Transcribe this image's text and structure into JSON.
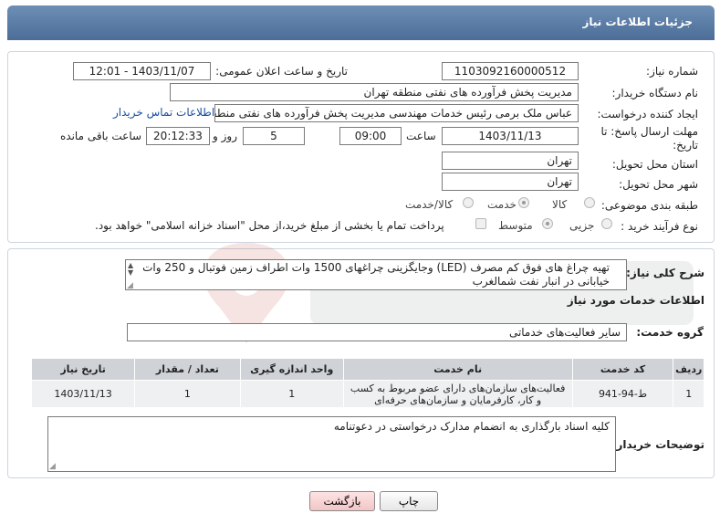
{
  "header": {
    "title": "جزئیات اطلاعات نیاز"
  },
  "form": {
    "need_number": {
      "label": "شماره نیاز:",
      "value": "1103092160000512"
    },
    "announce_datetime": {
      "label": "تاریخ و ساعت اعلان عمومی:",
      "value": "1403/11/07 - 12:01"
    },
    "buyer_org": {
      "label": "نام دستگاه خریدار:",
      "value": "مدیریت پخش فرآورده های نفتی منطقه تهران"
    },
    "requester": {
      "label": "ایجاد کننده درخواست:",
      "value": "عباس ملک برمی رئیس خدمات مهندسی مدیریت پخش فرآورده های نفتی منطقه تهران",
      "contact_link": "اطلاعات تماس خریدار"
    },
    "deadline": {
      "label_line1": "مهلت ارسال پاسخ: تا",
      "label_line2": "تاریخ:",
      "date": "1403/11/13",
      "time_label": "ساعت",
      "time": "09:00",
      "days": "5",
      "days_label": "روز و",
      "remaining": "20:12:33",
      "remaining_label": "ساعت باقی مانده"
    },
    "province": {
      "label": "استان محل تحویل:",
      "value": "تهران"
    },
    "city": {
      "label": "شهر محل تحویل:",
      "value": "تهران"
    },
    "category": {
      "label": "طبقه بندی موضوعی:",
      "options": [
        "کالا",
        "خدمت",
        "کالا/خدمت"
      ],
      "selected": "خدمت"
    },
    "purchase_type": {
      "label": "نوع فرآیند خرید :",
      "options": [
        "جزیی",
        "متوسط"
      ],
      "selected": "متوسط",
      "treasury_note": "پرداخت تمام یا بخشی از مبلغ خرید،از محل \"اسناد خزانه اسلامی\" خواهد بود."
    }
  },
  "summary": {
    "label": "شرح کلی نیاز:",
    "text": "تهیه چراغ های فوق کم مصرف (LED) وجایگزینی چراغهای 1500 وات اطراف زمین فوتبال و 250 وات خیابانی در انبار نفت شمالغرب"
  },
  "services_section": {
    "title": "اطلاعات خدمات مورد نیاز"
  },
  "service_group": {
    "label": "گروه خدمت:",
    "value": "سایر فعالیت‌های خدماتی"
  },
  "table": {
    "headers": [
      "ردیف",
      "کد خدمت",
      "نام خدمت",
      "واحد اندازه گیری",
      "تعداد / مقدار",
      "تاریخ نیاز"
    ],
    "rows": [
      [
        "1",
        "ط-94-941",
        "فعالیت‌های سازمان‌های دارای عضو مربوط به کسب و کار، کارفرمایان و سازمان‌های حرفه‌ای",
        "1",
        "1",
        "1403/11/13"
      ]
    ]
  },
  "buyer_notes": {
    "label": "توضیحات خریدار:",
    "value": "کلیه اسناد بارگذاری به انضمام مدارک درخواستی در دعوتنامه"
  },
  "buttons": {
    "print": "چاپ",
    "back": "بازگشت"
  },
  "colors": {
    "header_bg": "#5a7ca6",
    "link": "#1a4fa0",
    "table_header": "#cfd3d8",
    "back_button": "#f3c6c6"
  }
}
